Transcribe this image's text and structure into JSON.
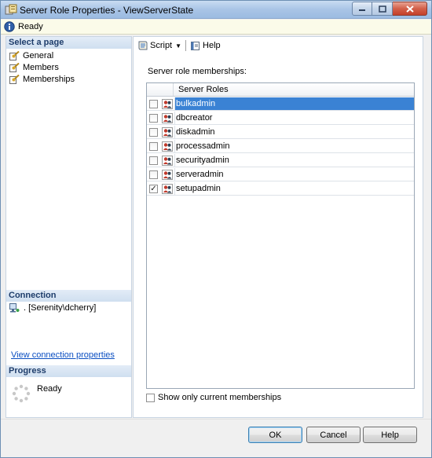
{
  "window": {
    "title": "Server Role Properties - ViewServerState"
  },
  "status": {
    "text": "Ready"
  },
  "left": {
    "select_page_header": "Select a page",
    "pages": [
      {
        "label": "General"
      },
      {
        "label": "Members"
      },
      {
        "label": "Memberships"
      }
    ],
    "connection_header": "Connection",
    "connection_value": ". [Serenity\\dcherry]",
    "view_connection_link": "View connection properties",
    "progress_header": "Progress",
    "progress_status": "Ready"
  },
  "toolbar": {
    "script_label": "Script",
    "help_label": "Help"
  },
  "main": {
    "memberships_label": "Server role memberships:",
    "grid_header": "Server Roles",
    "roles": [
      {
        "name": "bulkadmin",
        "checked": false,
        "selected": true
      },
      {
        "name": "dbcreator",
        "checked": false,
        "selected": false
      },
      {
        "name": "diskadmin",
        "checked": false,
        "selected": false
      },
      {
        "name": "processadmin",
        "checked": false,
        "selected": false
      },
      {
        "name": "securityadmin",
        "checked": false,
        "selected": false
      },
      {
        "name": "serveradmin",
        "checked": false,
        "selected": false
      },
      {
        "name": "setupadmin",
        "checked": true,
        "selected": false
      }
    ],
    "show_only_label": "Show only current memberships"
  },
  "buttons": {
    "ok": "OK",
    "cancel": "Cancel",
    "help": "Help"
  }
}
